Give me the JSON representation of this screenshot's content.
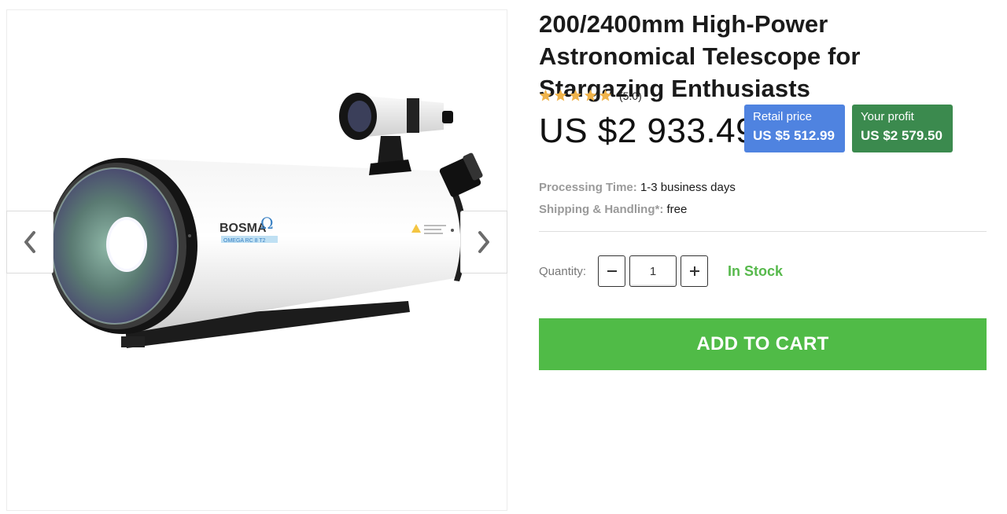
{
  "product": {
    "title": "200/2400mm High-Power Astronomical Telescope for Stargazing Enthusiasts",
    "rating": 5,
    "rating_text": "(5.0)",
    "price": "US $2 933.49",
    "retail": {
      "label": "Retail price",
      "value": "US $5 512.99"
    },
    "profit": {
      "label": "Your profit",
      "value": "US $2 579.50"
    },
    "image_brand": "BOSMA",
    "image_sub": "OMEGA  RC 8 T2"
  },
  "details": {
    "processing_label": "Processing Time:",
    "processing_value": "1-3 business days",
    "shipping_label": "Shipping & Handling*:",
    "shipping_value": "free"
  },
  "purchase": {
    "quantity_label": "Quantity:",
    "quantity_value": "1",
    "stock_status": "In Stock",
    "add_to_cart": "ADD TO CART"
  },
  "colors": {
    "star": "#f0b34a",
    "retail_bg": "#4f83e0",
    "profit_bg": "#3b8a4e",
    "stock": "#57b94c",
    "cart_bg": "#50bb47"
  },
  "icons": {
    "prev": "chevron-left-icon",
    "next": "chevron-right-icon",
    "minus": "minus-icon",
    "plus": "plus-icon",
    "star": "star-icon"
  }
}
